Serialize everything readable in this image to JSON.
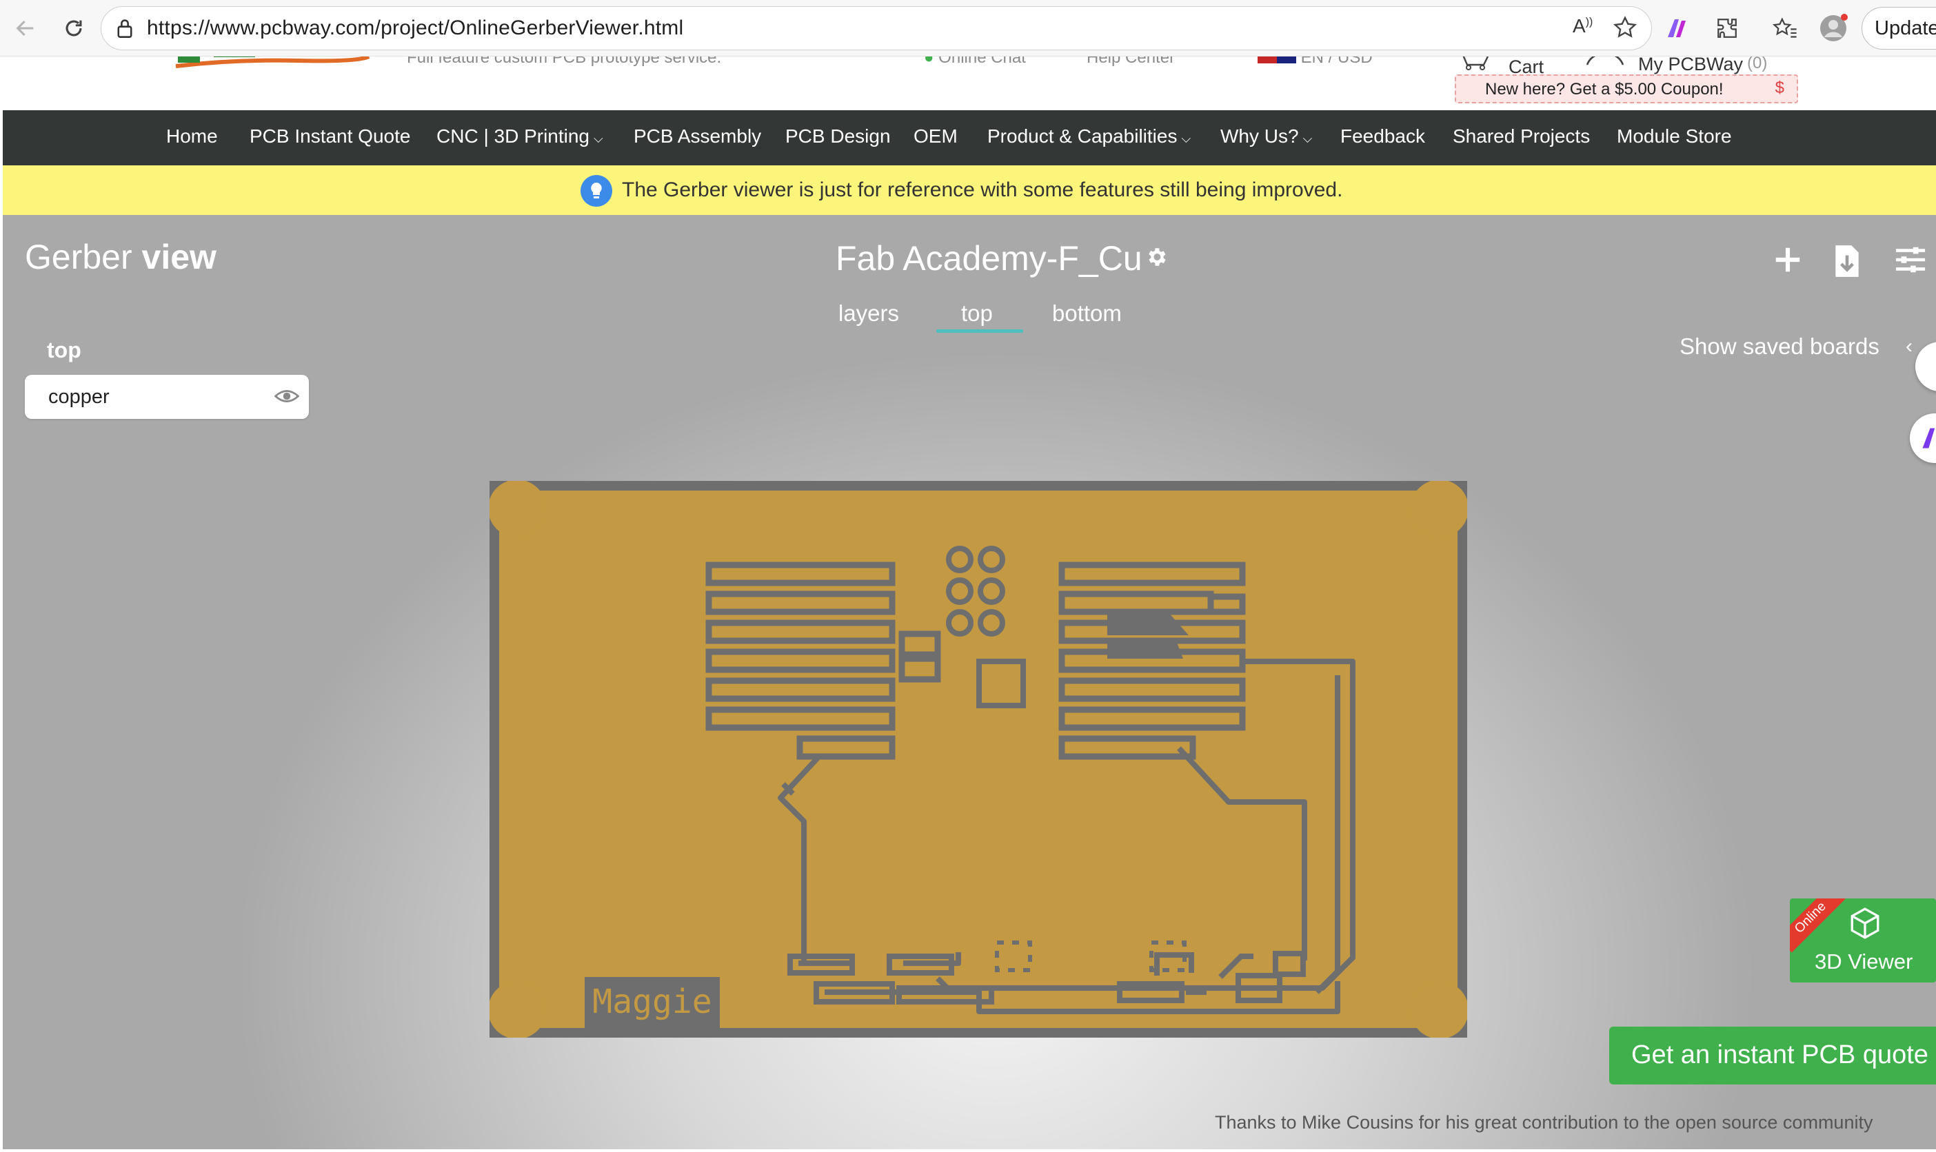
{
  "browser": {
    "url": "https://www.pcbway.com/project/OnlineGerberViewer.html",
    "update_label": "Update",
    "icons": [
      "back-icon",
      "reload-icon",
      "lock-icon",
      "read-aloud-icon",
      "favorite-star-icon",
      "copilot-icon",
      "extensions-icon",
      "favorites-icon",
      "profile-icon"
    ]
  },
  "header": {
    "tagline": "Full feature custom PCB prototype service.",
    "online_chat": "Online Chat",
    "help_center": "Help Center",
    "currency": "EN / USD",
    "cart_label": "Cart",
    "mypcbway_label": "My PCBWay",
    "mypcbway_count": "(0)",
    "coupon_text": "New here? Get a $5.00 Coupon!",
    "coupon_symbol": "$"
  },
  "nav": {
    "items": [
      {
        "label": "Home"
      },
      {
        "label": "PCB Instant Quote"
      },
      {
        "label": "CNC | 3D Printing",
        "dropdown": true
      },
      {
        "label": "PCB Assembly"
      },
      {
        "label": "PCB Design"
      },
      {
        "label": "OEM"
      },
      {
        "label": "Product & Capabilities",
        "dropdown": true
      },
      {
        "label": "Why Us?",
        "dropdown": true
      },
      {
        "label": "Feedback"
      },
      {
        "label": "Shared Projects"
      },
      {
        "label": "Module Store"
      }
    ]
  },
  "notice": {
    "text": "The Gerber viewer is just for reference with some features still being improved."
  },
  "viewer": {
    "title_light": "Gerber",
    "title_bold": "view",
    "board_name": "Fab Academy-F_Cu",
    "tabs": [
      "layers",
      "top",
      "bottom"
    ],
    "active_tab": "top",
    "show_saved_boards": "Show saved boards",
    "side_label": "top",
    "layers": [
      {
        "name": "copper",
        "visible": true
      }
    ],
    "board_text": "Maggie",
    "board_colors": {
      "copper": "#c39a43",
      "substrate": "#6e6e6e"
    },
    "viewer3d_badge": "Online",
    "viewer3d_label": "3D Viewer",
    "quote_button": "Get an instant PCB quote",
    "credit": "Thanks to Mike Cousins for his great contribution to the open source community"
  },
  "colors": {
    "nav_bg": "#333836",
    "notice_bg": "#fbf57c",
    "accent_green": "#3fb04b",
    "tab_underline": "#4dbfbf"
  }
}
